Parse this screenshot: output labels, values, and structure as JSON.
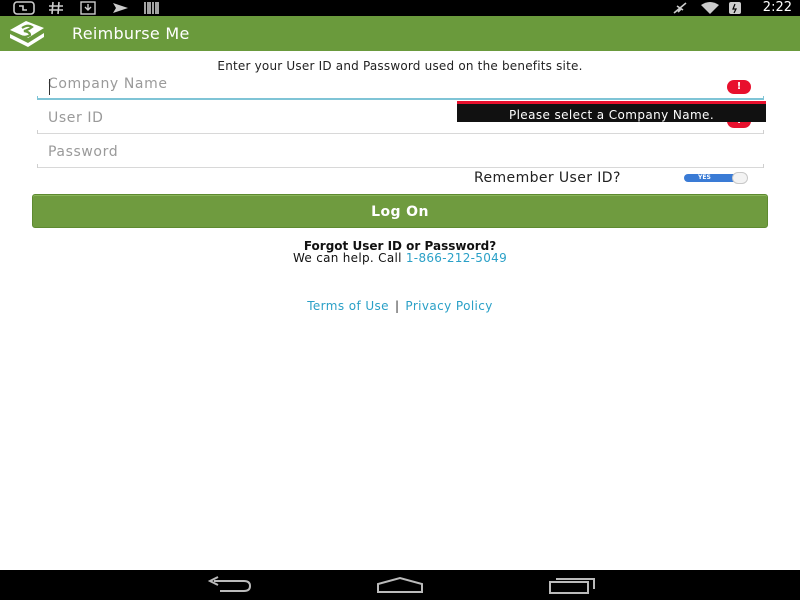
{
  "status_bar": {
    "time": "2:22",
    "icons": [
      "usb-debug-icon",
      "hash-icon",
      "download-icon",
      "send-icon",
      "barcode-icon",
      "airplane-icon",
      "wifi-icon",
      "battery-icon"
    ]
  },
  "action_bar": {
    "title": "Reimburse Me",
    "logo": "app-logo-icon",
    "background": "#6a9a3c"
  },
  "form": {
    "instructions": "Enter your User ID and Password used on the benefits site.",
    "company_placeholder": "Company Name",
    "user_id_placeholder": "User ID",
    "password_placeholder": "Password",
    "error_message": "Please select a Company Name.",
    "remember_label": "Remember User ID?",
    "remember_toggle": "YES",
    "login_label": "Log On"
  },
  "help": {
    "title": "Forgot User ID or Password?",
    "text": "We can help. Call",
    "phone": "1-866-212-5049"
  },
  "footer": {
    "terms": "Terms of Use",
    "separator": "|",
    "privacy": "Privacy Policy"
  },
  "colors": {
    "accent_green": "#6f9b3f",
    "link_blue": "#2aa0c7",
    "error_red": "#e8102d"
  }
}
